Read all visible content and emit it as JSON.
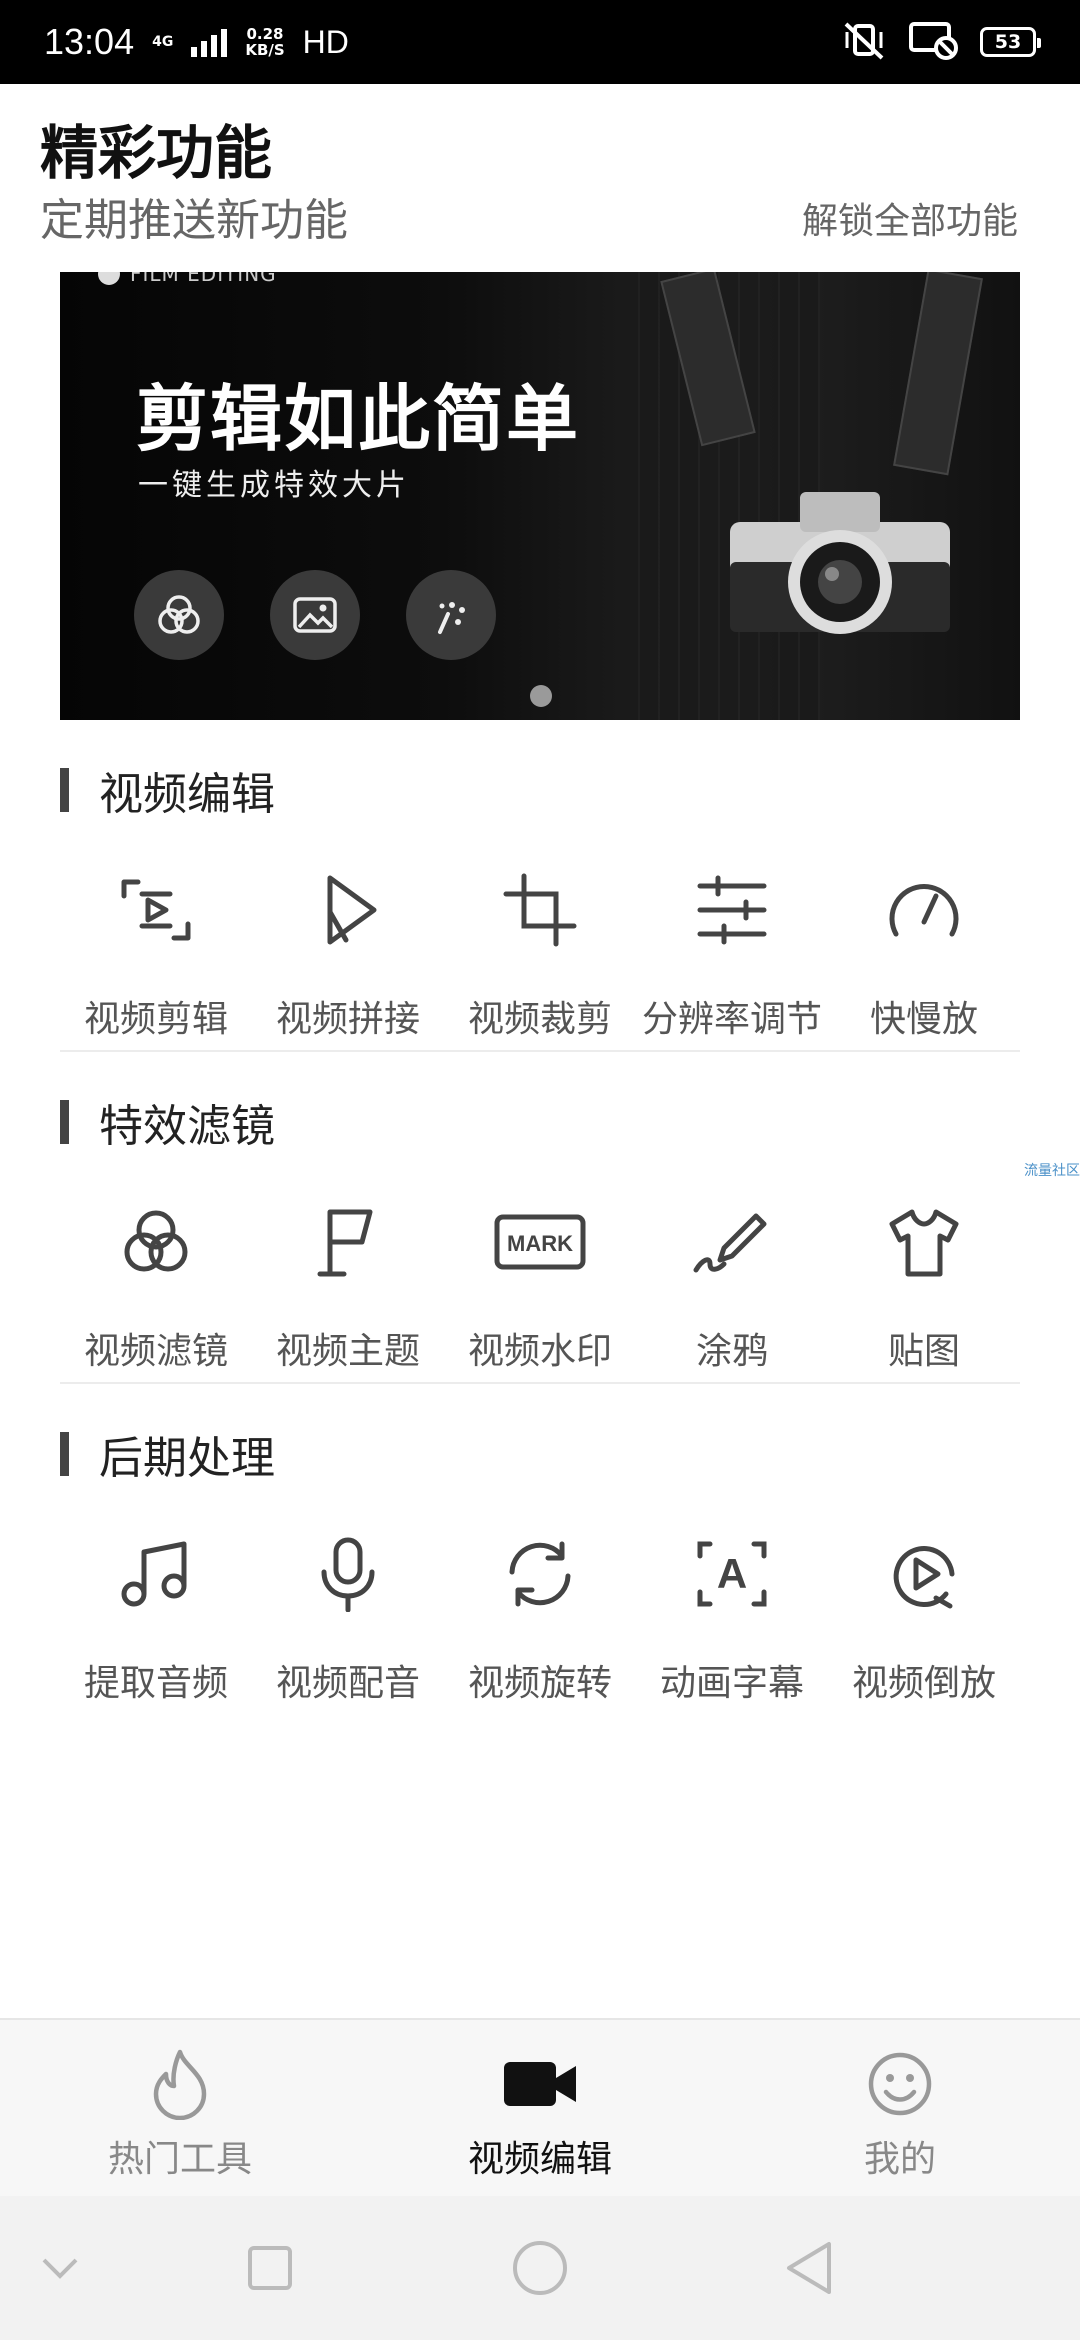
{
  "status_bar": {
    "time": "13:04",
    "network": "4G",
    "speed_value": "0.28",
    "speed_unit": "KB/S",
    "hd": "HD",
    "battery": "53"
  },
  "header": {
    "title": "精彩功能",
    "subtitle": "定期推送新功能",
    "unlock_label": "解锁全部功能"
  },
  "banner": {
    "tag": "FILM EDITING",
    "headline": "剪辑如此简单",
    "tagline": "一键生成特效大片",
    "buttons": [
      {
        "icon": "filter-circles-icon"
      },
      {
        "icon": "image-icon"
      },
      {
        "icon": "magic-wand-icon"
      }
    ],
    "page_count": 1,
    "current_page": 1
  },
  "sections": [
    {
      "title": "视频编辑",
      "tools": [
        {
          "label": "视频剪辑",
          "icon": "video-cut-icon"
        },
        {
          "label": "视频拼接",
          "icon": "video-join-icon"
        },
        {
          "label": "视频裁剪",
          "icon": "crop-icon"
        },
        {
          "label": "分辨率调节",
          "icon": "sliders-icon"
        },
        {
          "label": "快慢放",
          "icon": "speedometer-icon"
        }
      ]
    },
    {
      "title": "特效滤镜",
      "tools": [
        {
          "label": "视频滤镜",
          "icon": "filter-circles-icon"
        },
        {
          "label": "视频主题",
          "icon": "flag-icon"
        },
        {
          "label": "视频水印",
          "icon": "mark-watermark-icon",
          "icon_text": "MARK"
        },
        {
          "label": "涂鸦",
          "icon": "pen-scribble-icon"
        },
        {
          "label": "贴图",
          "icon": "tshirt-icon"
        }
      ]
    },
    {
      "title": "后期处理",
      "tools": [
        {
          "label": "提取音频",
          "icon": "music-note-icon"
        },
        {
          "label": "视频配音",
          "icon": "microphone-icon"
        },
        {
          "label": "视频旋转",
          "icon": "rotate-icon"
        },
        {
          "label": "动画字幕",
          "icon": "caption-a-icon",
          "icon_text": "A"
        },
        {
          "label": "视频倒放",
          "icon": "reverse-play-icon"
        }
      ]
    }
  ],
  "watermark": "流量社区",
  "bottom_nav": {
    "items": [
      {
        "label": "热门工具",
        "icon": "flame-icon",
        "active": false
      },
      {
        "label": "视频编辑",
        "icon": "video-camera-icon",
        "active": true
      },
      {
        "label": "我的",
        "icon": "smiley-icon",
        "active": false
      }
    ]
  },
  "colors": {
    "status_bar_bg": "#000000",
    "active_nav": "#111111",
    "inactive_nav": "#888888",
    "watermark": "#4a90c8"
  }
}
